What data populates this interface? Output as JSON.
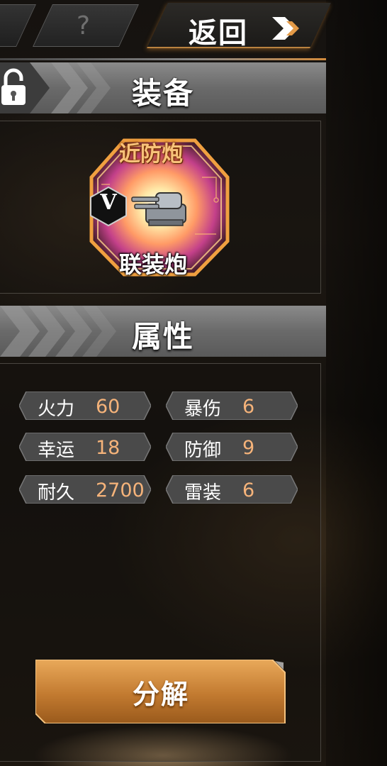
{
  "top_bar": {
    "help_label": "?",
    "back_label": "返回"
  },
  "equipment_section": {
    "title": "装备",
    "item": {
      "name_top": "近防炮",
      "name_bottom": "联装炮",
      "rank": "V",
      "icon": "twin-gun-turret-icon"
    }
  },
  "attributes_section": {
    "title": "属性",
    "stats": [
      {
        "label": "火力",
        "value": "60"
      },
      {
        "label": "暴伤",
        "value": "6"
      },
      {
        "label": "幸运",
        "value": "18"
      },
      {
        "label": "防御",
        "value": "9"
      },
      {
        "label": "耐久",
        "value": "2700"
      },
      {
        "label": "雷装",
        "value": "6"
      }
    ]
  },
  "actions": {
    "decompose_label": "分解"
  },
  "colors": {
    "accent_orange": "#d18a3c",
    "stat_value": "#f5b37a",
    "header_grey": "#7a7a7a"
  }
}
